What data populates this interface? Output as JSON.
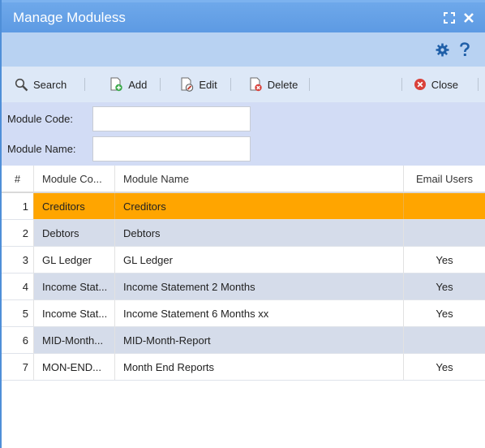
{
  "window": {
    "title": "Manage Moduless",
    "colors": {
      "titlebar": "#5d9ae3",
      "selected_row": "#ffa500",
      "alt_row": "#d5dcea"
    }
  },
  "toolbar": {
    "search": "Search",
    "add": "Add",
    "edit": "Edit",
    "delete": "Delete",
    "close": "Close"
  },
  "filters": {
    "module_code_label": "Module Code:",
    "module_code_value": "",
    "module_name_label": "Module Name:",
    "module_name_value": ""
  },
  "grid": {
    "headers": [
      "#",
      "Module Co...",
      "Module Name",
      "Email Users"
    ],
    "rows": [
      {
        "num": "1",
        "code": "Creditors",
        "name": "Creditors",
        "email": ""
      },
      {
        "num": "2",
        "code": "Debtors",
        "name": "Debtors",
        "email": ""
      },
      {
        "num": "3",
        "code": "GL Ledger",
        "name": "GL Ledger",
        "email": "Yes"
      },
      {
        "num": "4",
        "code": "Income Stat...",
        "name": "Income Statement 2 Months",
        "email": "Yes"
      },
      {
        "num": "5",
        "code": "Income Stat...",
        "name": "Income Statement 6 Months xx",
        "email": "Yes"
      },
      {
        "num": "6",
        "code": "MID-Month...",
        "name": "MID-Month-Report",
        "email": ""
      },
      {
        "num": "7",
        "code": "MON-END...",
        "name": "Month End Reports",
        "email": "Yes"
      }
    ]
  }
}
